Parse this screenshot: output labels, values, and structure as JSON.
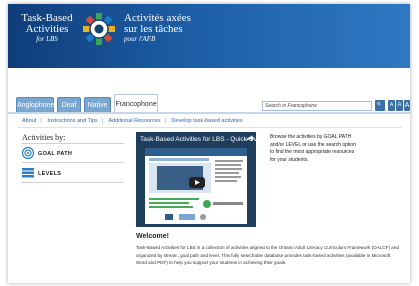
{
  "header": {
    "title_en_lines": [
      "Task-Based",
      "Activities"
    ],
    "title_en_sub": "for LBS",
    "title_fr_lines": [
      "Activités axées",
      "sur les tâches"
    ],
    "title_fr_sub": "pour l'AFB"
  },
  "tabs": [
    {
      "label": "Anglophone"
    },
    {
      "label": "Deaf"
    },
    {
      "label": "Native"
    },
    {
      "label": "Francophone"
    }
  ],
  "search": {
    "placeholder": "Search in Francophone",
    "go_glyph": "🔍",
    "size_buttons": [
      "A",
      "A",
      "A"
    ]
  },
  "subnav": [
    "About",
    "Instructions and Tips",
    "Additional Resources",
    "Develop task-based activities"
  ],
  "sidebar": {
    "heading": "Activities by:",
    "items": [
      {
        "label": "GOAL PATH",
        "icon": "goal-path-target-icon"
      },
      {
        "label": "LEVELS",
        "icon": "levels-stack-icon"
      }
    ]
  },
  "video": {
    "title": "Task-Based Activities for LBS - Quick Overvi..."
  },
  "description": "Browse the activities by GOAL PATH and/or LEVEL or use the search option to find the most appropriate resources for your students.",
  "welcome": {
    "heading": "Welcome!",
    "text": "Task-Based Activities for LBS is a collection of activities aligned to the Ontario Adult Literacy Curriculum Framework (OALCF) and organized by stream, goal path and level. This fully searchable database provides task-based activities (available in Microsoft Word and PDF) to help you support your students in achieving their goals."
  },
  "colors": {
    "banner": "#1d5ea6",
    "tab": "#7aa6cf",
    "link": "#2d6aa8",
    "video_bg": "#1f3e5e"
  }
}
